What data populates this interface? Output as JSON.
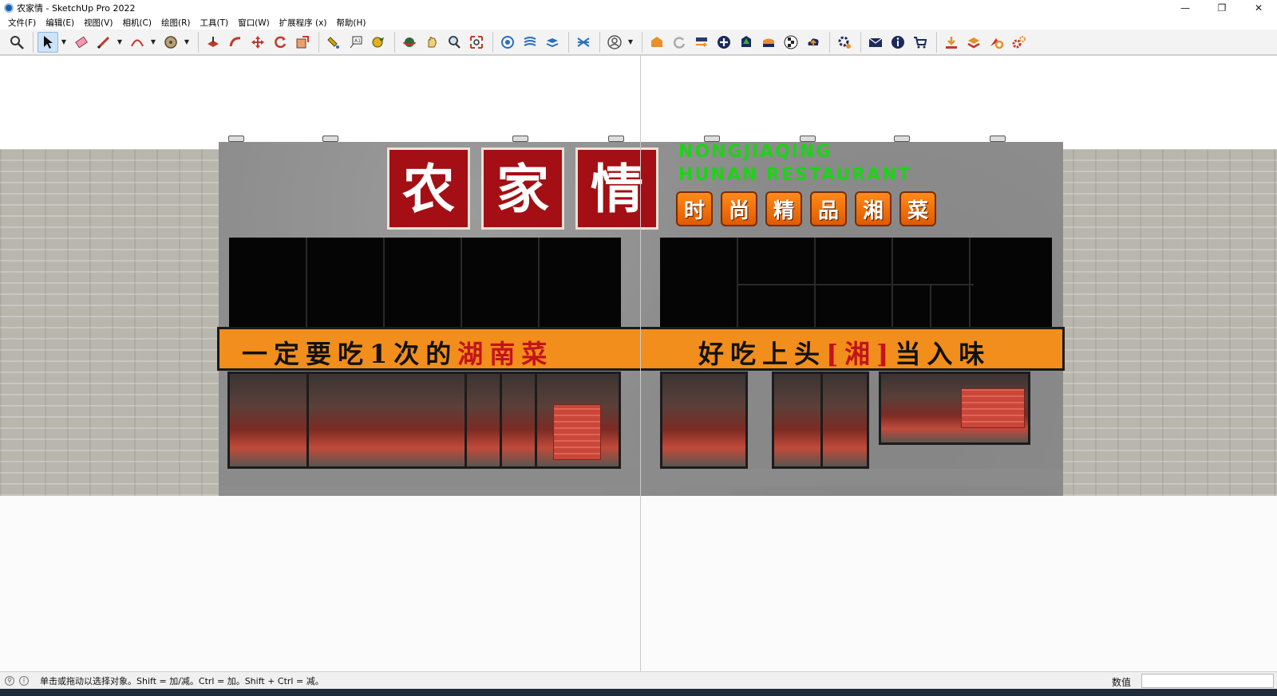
{
  "window": {
    "title": "农家情 - SketchUp Pro 2022",
    "controls": [
      "—",
      "❐",
      "✕"
    ]
  },
  "menu": [
    "文件(F)",
    "编辑(E)",
    "视图(V)",
    "相机(C)",
    "绘图(R)",
    "工具(T)",
    "窗口(W)",
    "扩展程序 (x)",
    "帮助(H)"
  ],
  "toolbar": {
    "icons": [
      "zoom-icon",
      "select-icon",
      "eraser-icon",
      "pencil-icon",
      "arc-icon",
      "tape-icon",
      "push-pull-icon",
      "follow-me-icon",
      "move-icon",
      "rotate-icon",
      "scale-icon",
      "paint-icon",
      "text-icon",
      "section-icon",
      "orbit-icon",
      "pan-icon",
      "zoom-window-icon",
      "zoom-extents-icon",
      "styles-icon",
      "layers-icon",
      "components-icon",
      "account-icon",
      "warehouse-icon",
      "refresh-icon",
      "share-icon",
      "add-icon",
      "tree-icon",
      "materials-icon",
      "checker-icon",
      "upload-icon",
      "settings-icon",
      "mail-icon",
      "info-icon",
      "cart-icon",
      "download-icon",
      "plugin-icon",
      "plugin-tools-icon"
    ],
    "accent": "#cde3f7"
  },
  "scene": {
    "sign_chars": [
      "农",
      "家",
      "情"
    ],
    "english_line1": "NONGJIAQING",
    "english_line2": "HUNAN RESTAURANT",
    "slogan_tiles": [
      "时",
      "尚",
      "精",
      "品",
      "湘",
      "菜"
    ],
    "banner_left_black": "一定要吃1次的",
    "banner_left_red": "湖南菜",
    "banner_right_black1": "好吃上头",
    "banner_right_red": "[湘]",
    "banner_right_black2": "当入味",
    "colors": {
      "sign_red": "#a30f14",
      "english_green": "#20d11a",
      "banner_orange": "#f28e1c",
      "banner_red_text": "#c3131a"
    }
  },
  "status": {
    "message": "单击或拖动以选择对象。Shift = 加/减。Ctrl = 加。Shift + Ctrl = 减。",
    "vcb_label": "数值",
    "vcb_value": ""
  }
}
